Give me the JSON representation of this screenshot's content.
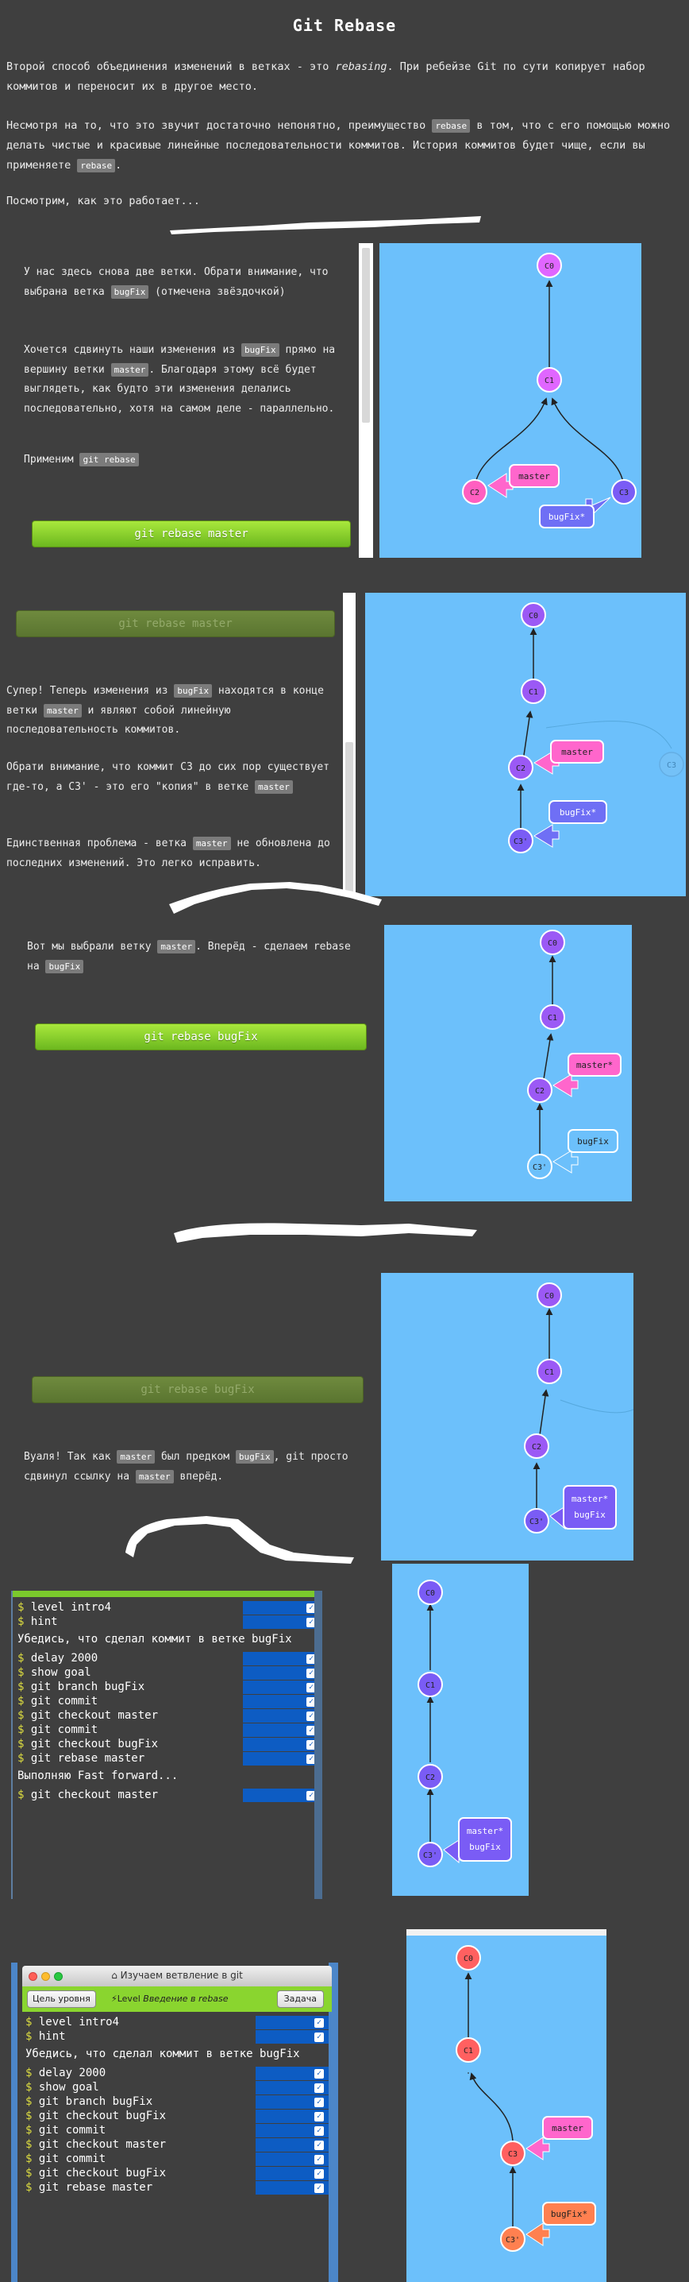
{
  "title": "Git Rebase",
  "intro": {
    "p1_a": "Второй способ объединения изменений в ветках - это ",
    "p1_em": "rebasing",
    "p1_b": ". При ребейзе Git по сути копирует набор коммитов и переносит их в другое место.",
    "p2_a": "Несмотря на то, что это звучит достаточно непонятно, преимущество ",
    "p2_code1": "rebase",
    "p2_b": " в том, что с его помощью можно делать чистые и красивые линейные последовательности коммитов. История коммитов будет чище, если вы применяете ",
    "p2_code2": "rebase",
    "p2_c": ".",
    "p3": "Посмотрим, как это работает..."
  },
  "step1": {
    "a1": "У нас здесь снова две ветки. Обрати внимание, что выбрана ветка ",
    "c1": "bugFix",
    "a2": " (отмечена звёздочкой)",
    "b1": "Хочется сдвинуть наши изменения из ",
    "c2": "bugFix",
    "b2": " прямо на вершину ветки ",
    "c3": "master",
    "b3": ". Благодаря этому всё будет выглядеть, как будто эти изменения делались последовательно, хотя на самом деле - параллельно.",
    "d1": "Применим ",
    "c4": "git rebase",
    "button": "git rebase master"
  },
  "step2": {
    "button": "git rebase master",
    "a1": "Супер! Теперь изменения из ",
    "c1": "bugFix",
    "a2": " находятся в конце ветки ",
    "c2": "master",
    "a3": " и являют собой линейную последовательность коммитов.",
    "b1": "Обрати внимание, что коммит C3 до сих пор существует где-то, а C3' - это его \"копия\" в ветке ",
    "c3": "master",
    "d1": "Единственная проблема - ветка ",
    "c4": "master",
    "d2": " не обновлена до последних изменений. Это легко исправить."
  },
  "step3": {
    "a1": "Вот мы выбрали ветку ",
    "c1": "master",
    "a2": ". Вперёд - сделаем rebase на ",
    "c2": "bugFix",
    "button": "git rebase bugFix"
  },
  "step4": {
    "button": "git rebase bugFix",
    "a1": "Вуаля! Так как ",
    "c1": "master",
    "a2": " был предком ",
    "c2": "bugFix",
    "a3": ", git просто сдвинул ссылку на ",
    "c3": "master",
    "a4": " вперёд."
  },
  "commits": {
    "c0": "C0",
    "c1": "C1",
    "c2": "C2",
    "c3": "C3",
    "c3p": "C3'",
    "master": "master",
    "master_star": "master*",
    "bugfix": "bugFix",
    "bugfix_star": "bugFix*"
  },
  "terminal1": {
    "rows_a": [
      "level intro4",
      "hint"
    ],
    "message1": "Убедись, что сделал коммит в ветке bugFix",
    "rows_b": [
      "delay 2000",
      "show goal",
      "git branch bugFix",
      "git commit",
      "git checkout master",
      "git commit",
      "git checkout bugFix",
      "git rebase master"
    ],
    "message2": "Выполняю Fast forward...",
    "rows_c": [
      "git checkout master"
    ]
  },
  "window": {
    "title": "Изучаем ветвление в git",
    "level_button": "Цель уровня",
    "level_label_prefix": "Level ",
    "level_label_name": "Введение в rebase",
    "task_button": "Задача"
  },
  "terminal2": {
    "rows_a": [
      "level intro4",
      "hint"
    ],
    "message1": "Убедись, что сделал коммит в ветке bugFix",
    "rows_b": [
      "delay 2000",
      "show goal",
      "git branch bugFix",
      "git checkout bugFix",
      "git commit",
      "git checkout master",
      "git commit",
      "git checkout bugFix",
      "git rebase master"
    ]
  },
  "colors": {
    "background": "#3f3f3f",
    "visual_bg": "#6cc0fb",
    "commit_purple": "#9b59f5",
    "commit_magenta": "#e066ff",
    "commit_pink": "#ff5fc0",
    "commit_red": "#ff6060",
    "commit_orange": "#ff8050",
    "branch_pink": "#ff66cc",
    "branch_blue": "#6f6ff5",
    "terminal_blue": "#0d5cc3",
    "button_green": "#8ad52f"
  },
  "icons": [
    "home-icon",
    "lightning-icon",
    "check-icon",
    "window-close-icon",
    "window-minimize-icon",
    "window-maximize-icon"
  ]
}
